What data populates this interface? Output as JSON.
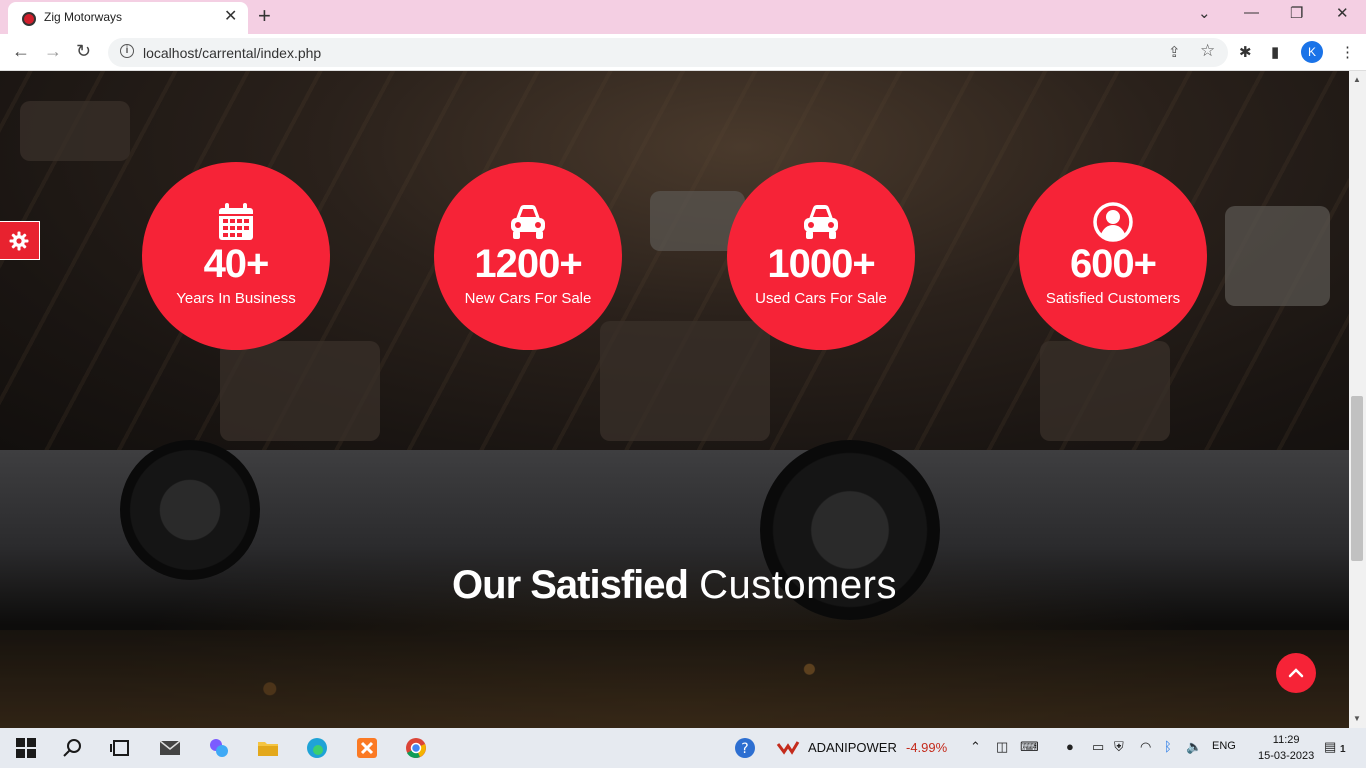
{
  "browser": {
    "tab_title": "Zig Motorways",
    "url": "localhost/carrental/index.php",
    "profile_initial": "K"
  },
  "stats": [
    {
      "icon": "calendar-icon",
      "number": "40+",
      "label": "Years In Business"
    },
    {
      "icon": "car-icon",
      "number": "1200+",
      "label": "New Cars For Sale"
    },
    {
      "icon": "car-icon",
      "number": "1000+",
      "label": "Used Cars For Sale"
    },
    {
      "icon": "user-circle-icon",
      "number": "600+",
      "label": "Satisfied Customers"
    }
  ],
  "customers_section": {
    "title_bold": "Our Satisfied",
    "title_light": "Customers"
  },
  "taskbar": {
    "ticker_name": "ADANIPOWER",
    "ticker_change": "-4.99%",
    "language": "ENG",
    "time": "11:29",
    "date": "15-03-2023",
    "notification_count": "1"
  },
  "colors": {
    "accent": "#f62337",
    "tab_strip": "#f4cfe3"
  }
}
